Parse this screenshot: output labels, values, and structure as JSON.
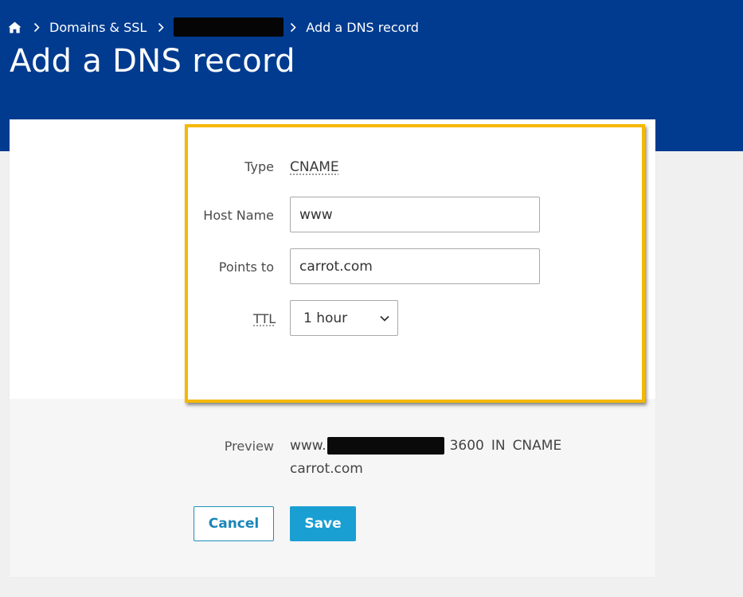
{
  "breadcrumb": {
    "home_icon": "home-icon",
    "separator_icon": "chevron-right-icon",
    "domains_label": "Domains & SSL",
    "current_label": "Add a DNS record"
  },
  "page": {
    "title": "Add a DNS record"
  },
  "form": {
    "type_label": "Type",
    "type_value": "CNAME",
    "host_label": "Host Name",
    "host_value": "www",
    "points_label": "Points to",
    "points_value": "carrot.com",
    "ttl_label": "TTL",
    "ttl_value": "1 hour"
  },
  "preview": {
    "label": "Preview",
    "prefix": "www.",
    "ttl": "3600",
    "class": "IN",
    "type": "CNAME",
    "target": "carrot.com"
  },
  "actions": {
    "cancel_label": "Cancel",
    "save_label": "Save"
  },
  "colors": {
    "header_bg": "#003b8f",
    "highlight_border": "#f5b800",
    "save_bg": "#1a9fd2",
    "cancel_text": "#1a86b8"
  }
}
